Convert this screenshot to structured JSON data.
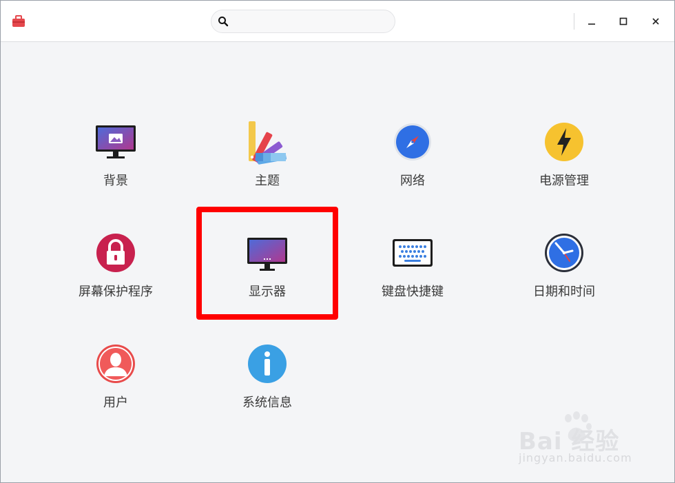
{
  "search": {
    "placeholder": ""
  },
  "tiles": [
    {
      "label": "背景"
    },
    {
      "label": "主题"
    },
    {
      "label": "网络"
    },
    {
      "label": "电源管理"
    },
    {
      "label": "屏幕保护程序"
    },
    {
      "label": "显示器"
    },
    {
      "label": "键盘快捷键"
    },
    {
      "label": "日期和时间"
    },
    {
      "label": "用户"
    },
    {
      "label": "系统信息"
    }
  ],
  "watermark": {
    "main": "Bai  经验",
    "sub": "jingyan.baidu.com"
  },
  "colors": {
    "highlight": "#ff0000",
    "accent": "#3b82f6"
  }
}
